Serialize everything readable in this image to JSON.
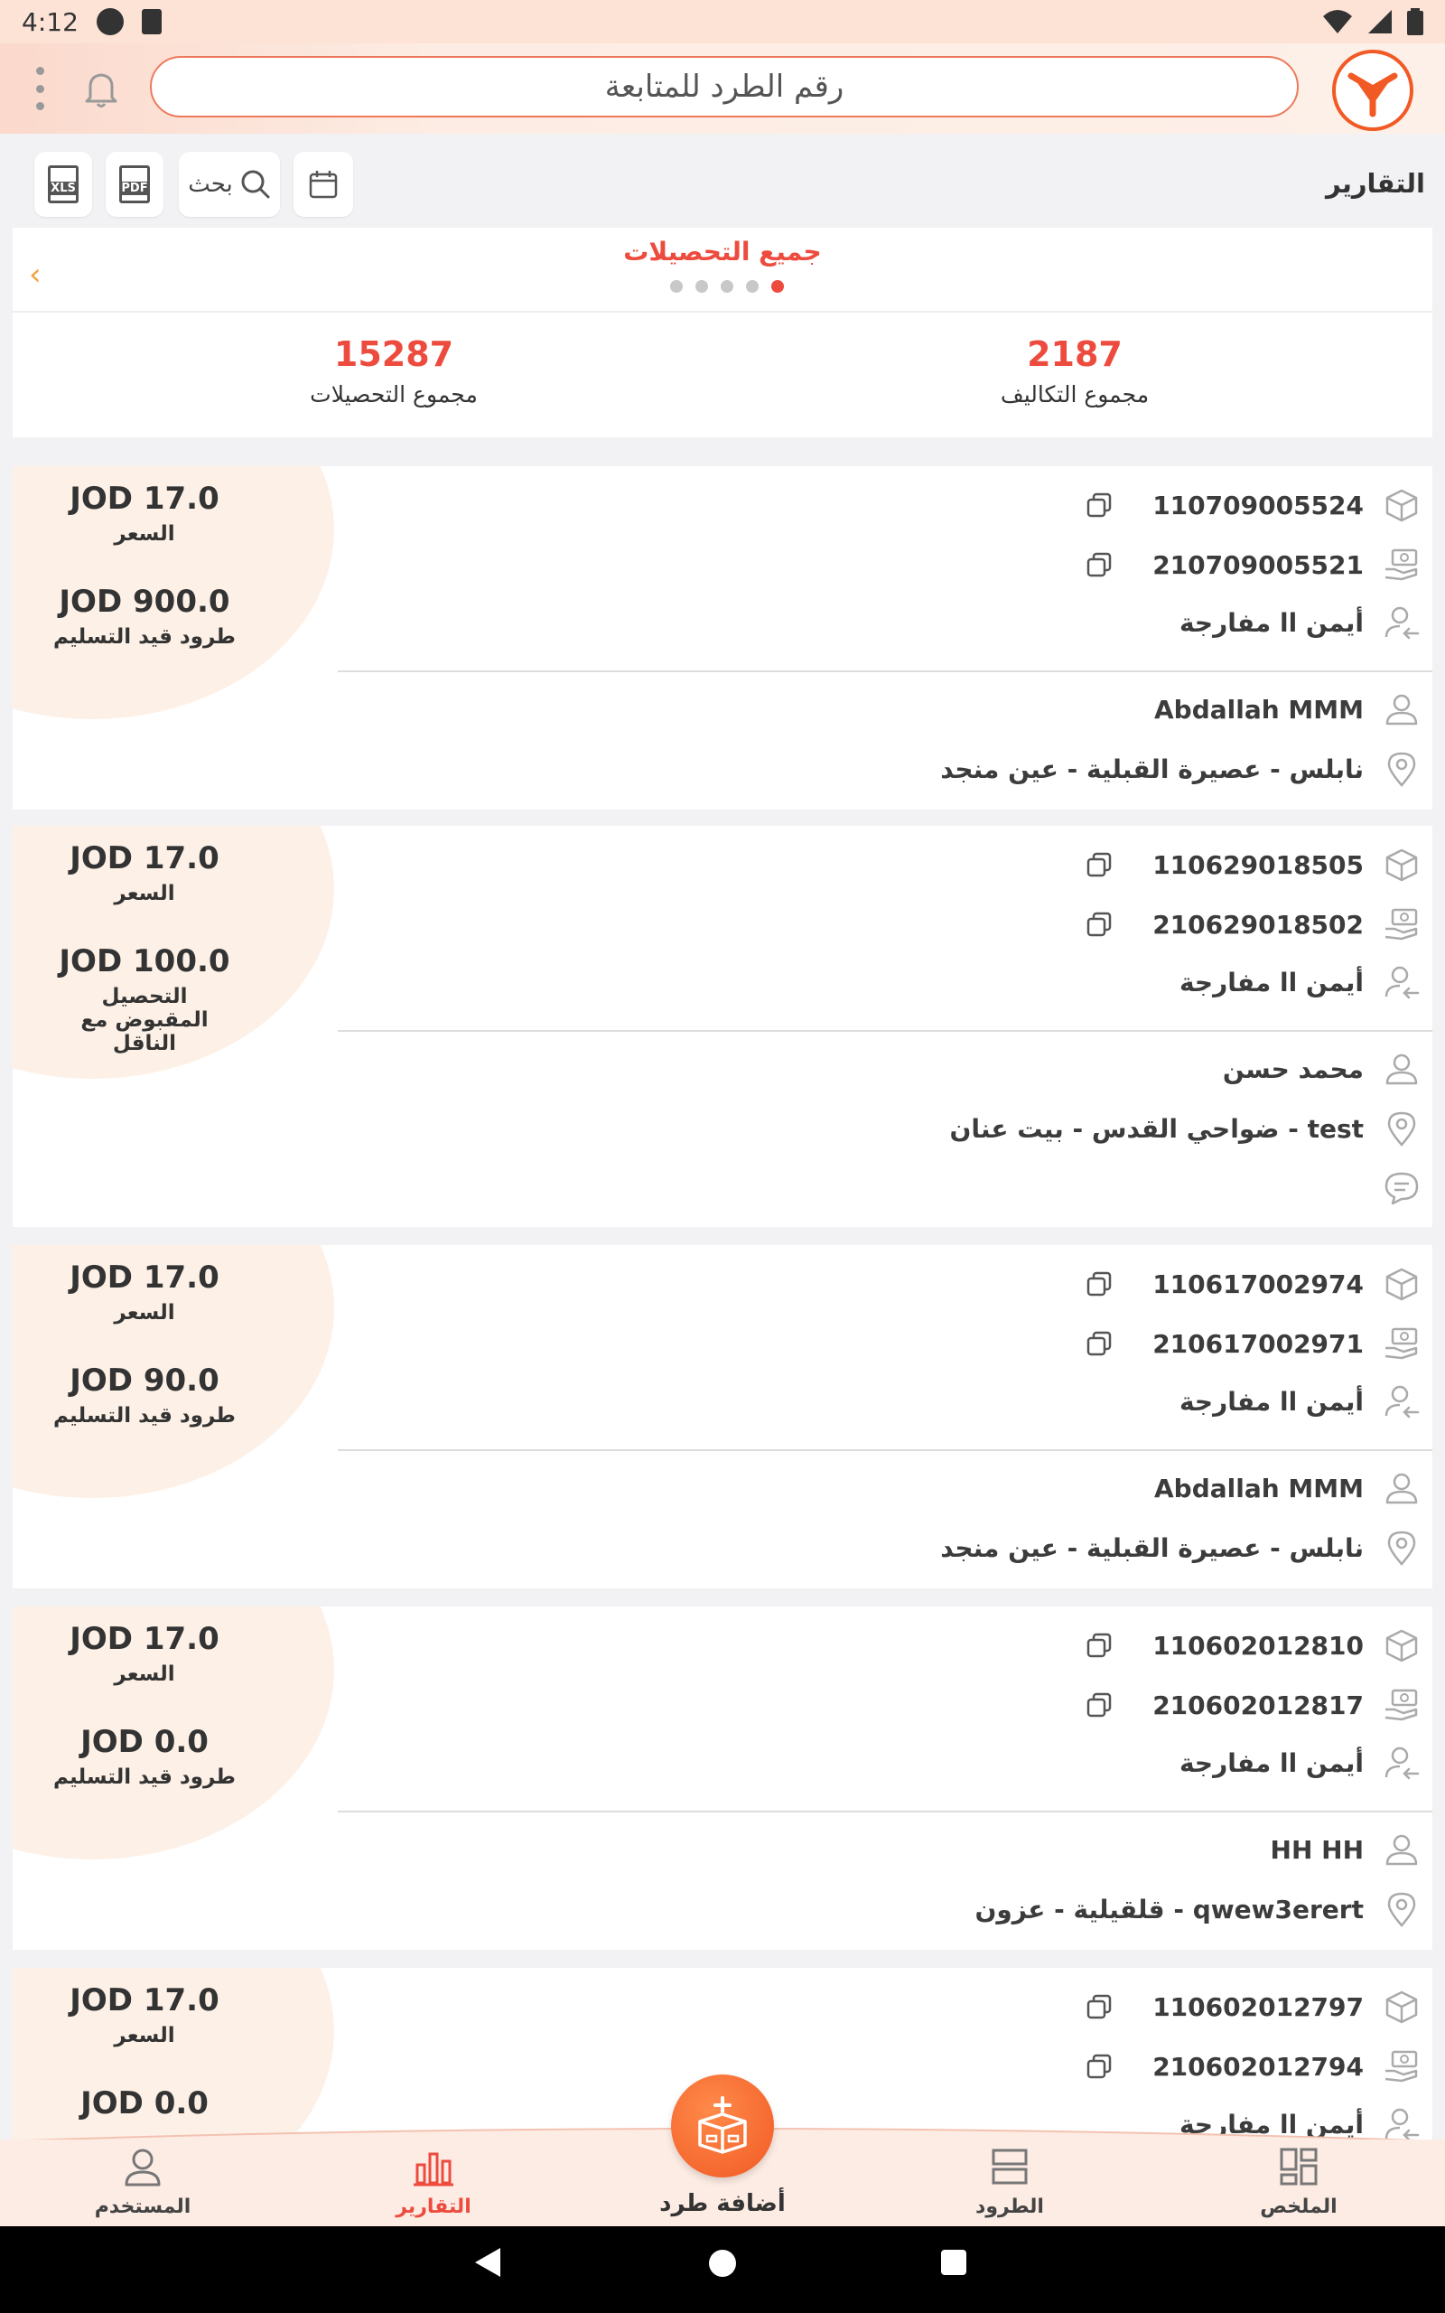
{
  "status_bar": {
    "time": "4:12"
  },
  "header": {
    "search_placeholder": "رقم الطرد للمتابعة"
  },
  "toolbar": {
    "title": "التقارير",
    "search_label": "بحث",
    "xls_label": "XLS",
    "pdf_label": "PDF"
  },
  "summary": {
    "title": "جميع التحصيلات",
    "page_count": 5,
    "active_page": 5,
    "total_collections": {
      "value": "15287",
      "label": "مجموع التحصيلات"
    },
    "total_costs": {
      "value": "2187",
      "label": "مجموع التكاليف"
    }
  },
  "cards": [
    {
      "price": "JOD 17.0",
      "price_label": "السعر",
      "amount": "JOD  900.0",
      "amount_label": "طرود قيد التسليم",
      "parcel_no": "110709005524",
      "receipt_no": "210709005521",
      "agent": "أيمن اا مفارجة",
      "customer": "Abdallah MMM",
      "address": "نابلس - عصيرة القبلية - عين منجد"
    },
    {
      "price": "JOD 17.0",
      "price_label": "السعر",
      "amount": "JOD  100.0",
      "amount_label": "التحصيل المقبوض مع الناقل",
      "parcel_no": "110629018505",
      "receipt_no": "210629018502",
      "agent": "أيمن اا مفارجة",
      "customer": "محمد حسن",
      "address": "ضواحي القدس - بيت عنان - test"
    },
    {
      "price": "JOD 17.0",
      "price_label": "السعر",
      "amount": "JOD  90.0",
      "amount_label": "طرود قيد التسليم",
      "parcel_no": "110617002974",
      "receipt_no": "210617002971",
      "agent": "أيمن اا مفارجة",
      "customer": "Abdallah MMM",
      "address": "نابلس - عصيرة القبلية - عين منجد"
    },
    {
      "price": "JOD 17.0",
      "price_label": "السعر",
      "amount": "JOD  0.0",
      "amount_label": "طرود قيد التسليم",
      "parcel_no": "110602012810",
      "receipt_no": "210602012817",
      "agent": "أيمن اا مفارجة",
      "customer": "HH HH",
      "address": "قلقيلية - عزون - qwew3erert"
    },
    {
      "price": "JOD 17.0",
      "price_label": "السعر",
      "amount": "JOD  0.0",
      "parcel_no": "110602012797",
      "receipt_no": "210602012794",
      "agent": "أيمن اا مفارجة"
    }
  ],
  "bottom_nav": {
    "user": "المستخدم",
    "reports": "التقارير",
    "add_parcel": "أضافة طرد",
    "parcels": "الطرود",
    "summary": "الملخص"
  },
  "colors": {
    "accent": "#ed4b3e",
    "brand_orange": "#f15a24",
    "header_bg": "#fde3d6"
  }
}
